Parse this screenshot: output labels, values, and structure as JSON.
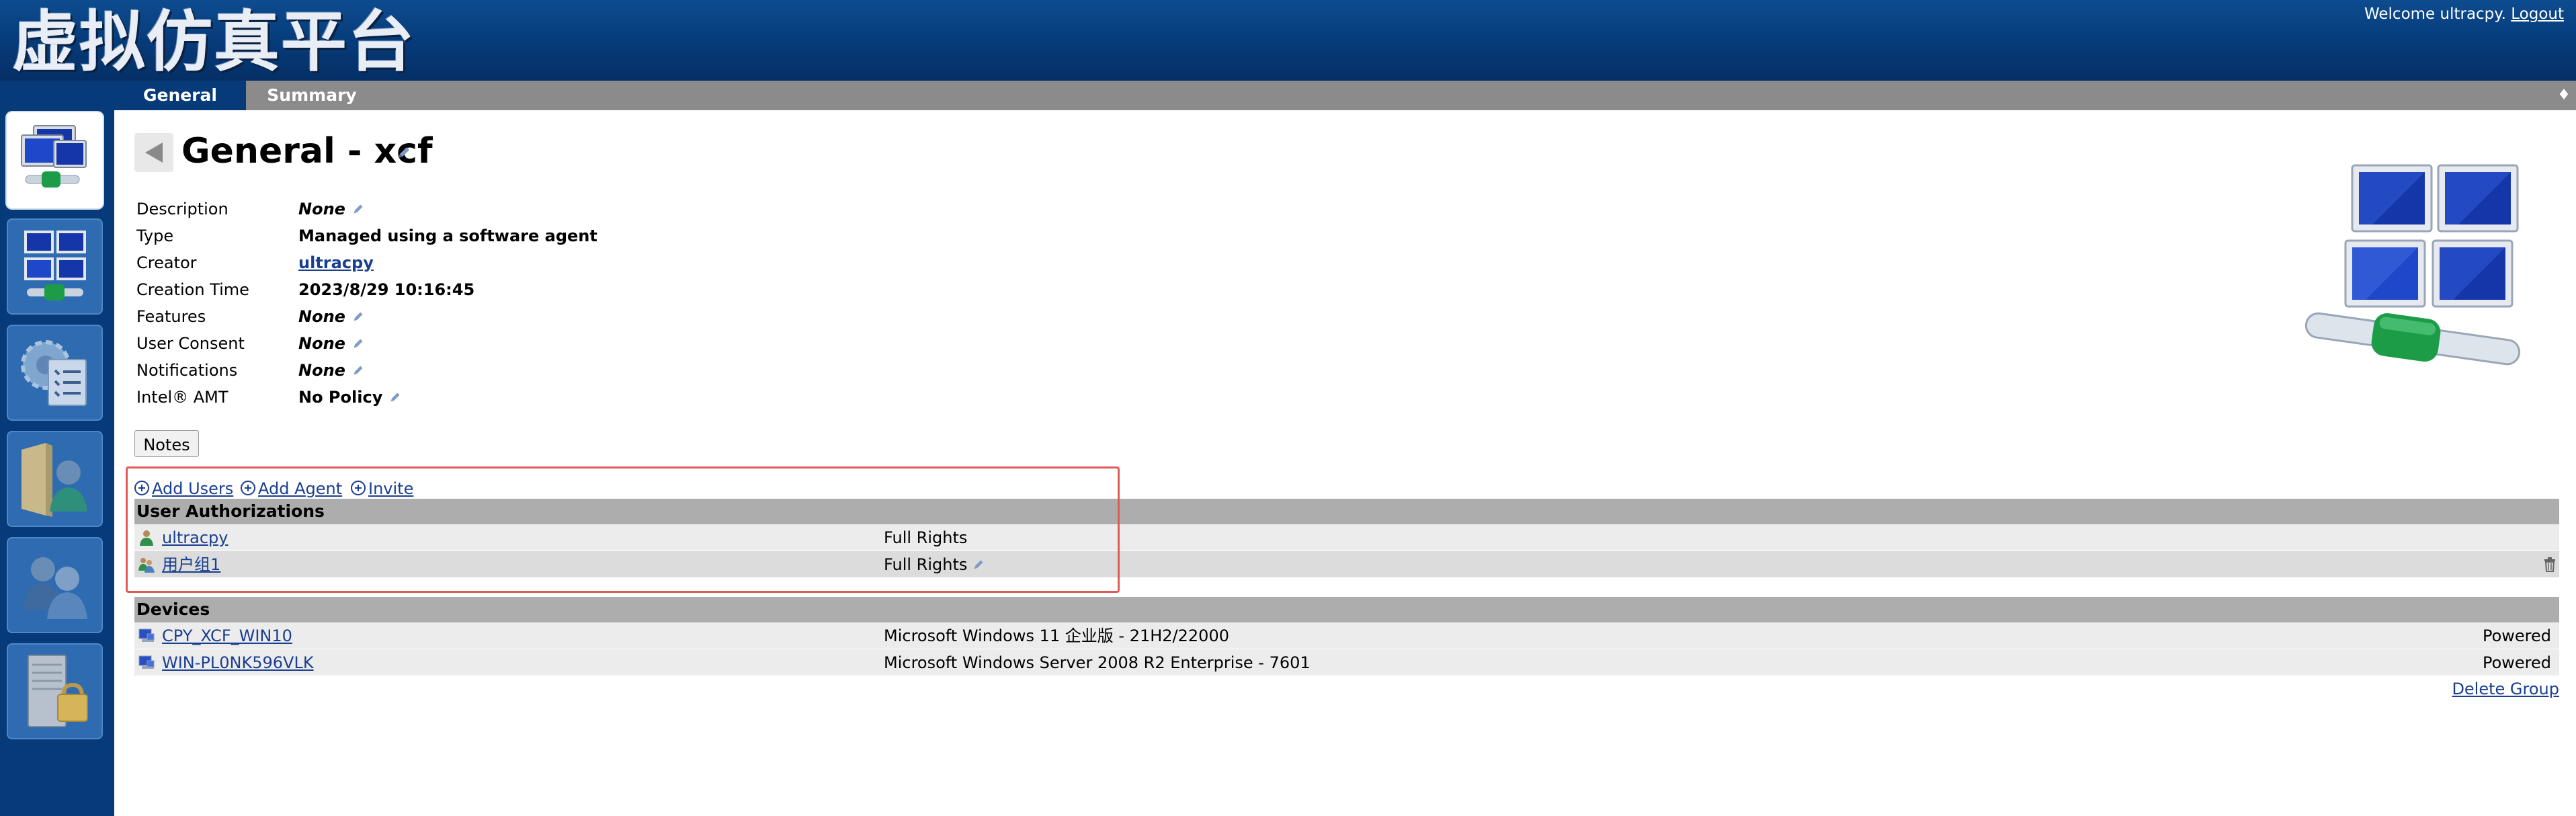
{
  "header": {
    "app_title": "虚拟仿真平台",
    "welcome_text": "Welcome ultracpy.",
    "logout_label": "Logout"
  },
  "sidebar": {
    "items": [
      {
        "name": "device-group-icon",
        "active": true
      },
      {
        "name": "multi-monitor-icon",
        "active": false
      },
      {
        "name": "settings-checklist-icon",
        "active": false
      },
      {
        "name": "user-folder-icon",
        "active": false
      },
      {
        "name": "users-icon",
        "active": false
      },
      {
        "name": "server-lock-icon",
        "active": false
      }
    ]
  },
  "tabs": [
    {
      "label": "General",
      "active": true
    },
    {
      "label": "Summary",
      "active": false
    }
  ],
  "tab_menu_glyph": "♦",
  "page": {
    "title": "General - xcf"
  },
  "properties": [
    {
      "label": "Description",
      "value": "None",
      "italic": true,
      "editable": true,
      "link": false
    },
    {
      "label": "Type",
      "value": "Managed using a software agent",
      "italic": false,
      "editable": false,
      "link": false
    },
    {
      "label": "Creator",
      "value": "ultracpy",
      "italic": false,
      "editable": false,
      "link": true
    },
    {
      "label": "Creation Time",
      "value": "2023/8/29 10:16:45",
      "italic": false,
      "editable": false,
      "link": false
    },
    {
      "label": "Features",
      "value": "None",
      "italic": true,
      "editable": true,
      "link": false
    },
    {
      "label": "User Consent",
      "value": "None",
      "italic": true,
      "editable": true,
      "link": false
    },
    {
      "label": "Notifications",
      "value": "None",
      "italic": true,
      "editable": true,
      "link": false
    },
    {
      "label": "Intel® AMT",
      "value": "No Policy",
      "italic": false,
      "editable": true,
      "link": false
    }
  ],
  "notes_label": "Notes",
  "actions": {
    "add_users": "Add Users",
    "add_agent": "Add Agent",
    "invite": "Invite"
  },
  "user_authorizations": {
    "header": "User Authorizations",
    "rows": [
      {
        "name": "ultracpy",
        "rights": "Full Rights",
        "editable": false,
        "deletable": false,
        "icon": "user-icon"
      },
      {
        "name": "用户组1",
        "rights": "Full Rights",
        "editable": true,
        "deletable": true,
        "icon": "user-group-icon"
      }
    ]
  },
  "devices": {
    "header": "Devices",
    "rows": [
      {
        "name": "CPY_XCF_WIN10",
        "os": "Microsoft Windows 11 企业版 - 21H2/22000",
        "state": "Powered"
      },
      {
        "name": "WIN-PL0NK596VLK",
        "os": "Microsoft Windows Server 2008 R2 Enterprise - 7601",
        "state": "Powered"
      }
    ]
  },
  "delete_group_label": "Delete Group",
  "colors": {
    "header_blue": "#063a78",
    "tab_gray": "#8b8b8b",
    "link_blue": "#1a3f8f",
    "highlight_red": "#e05a5a"
  }
}
